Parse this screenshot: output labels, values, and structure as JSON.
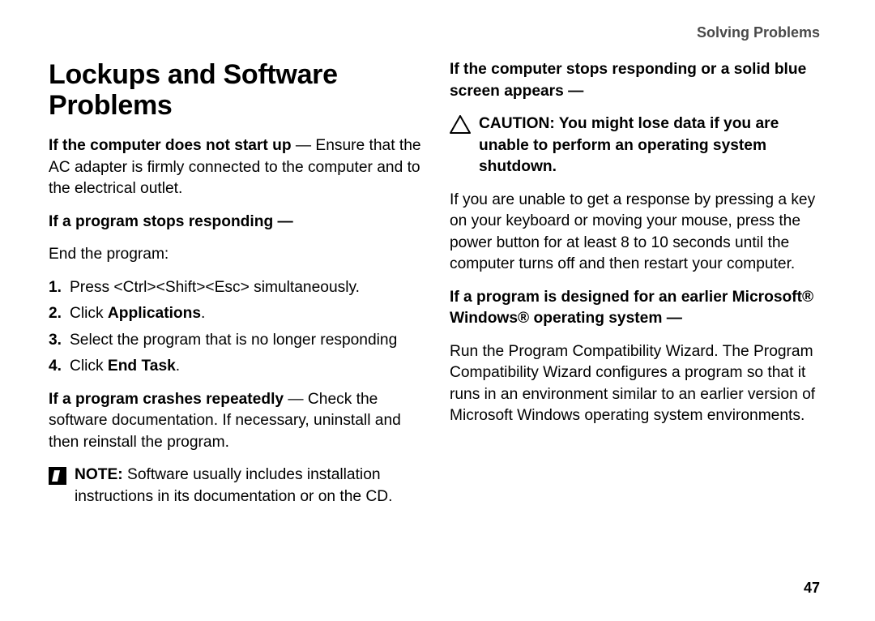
{
  "header": "Solving Problems",
  "title": "Lockups and Software Problems",
  "left": {
    "p1_bold": "If the computer does not start up",
    "p1_rest": " — Ensure that the AC adapter is firmly connected to the computer and to the electrical outlet.",
    "p2_bold": "If a program stops responding —",
    "p3": "End the program:",
    "steps": {
      "s1": "Press <Ctrl><Shift><Esc> simultaneously.",
      "s2_pre": "Click ",
      "s2_b": "Applications",
      "s2_post": ".",
      "s3": "Select the program that is no longer responding",
      "s4_pre": "Click ",
      "s4_b": "End Task",
      "s4_post": "."
    },
    "p4_bold": "If a program crashes repeatedly",
    "p4_rest": " — Check the software documentation. If necessary, uninstall and then reinstall the program.",
    "note_label": "NOTE:",
    "note_text": " Software usually includes installation instructions in its documentation or on the CD."
  },
  "right": {
    "p1_bold": "If the computer stops responding or a solid blue screen appears —",
    "caution_text": "CAUTION: You might lose data if you are unable to perform an operating system shutdown.",
    "p2": "If you are unable to get a response by pressing a key on your keyboard or moving your mouse, press the power button for at least 8 to 10 seconds until the computer turns off and then restart your computer.",
    "p3_bold": "If a program is designed for an earlier Microsoft® Windows® operating system —",
    "p4": "Run the Program Compatibility Wizard. The Program Compatibility Wizard configures a program so that it runs in an environment similar to an earlier version of Microsoft Windows operating system environments."
  },
  "page_number": "47"
}
